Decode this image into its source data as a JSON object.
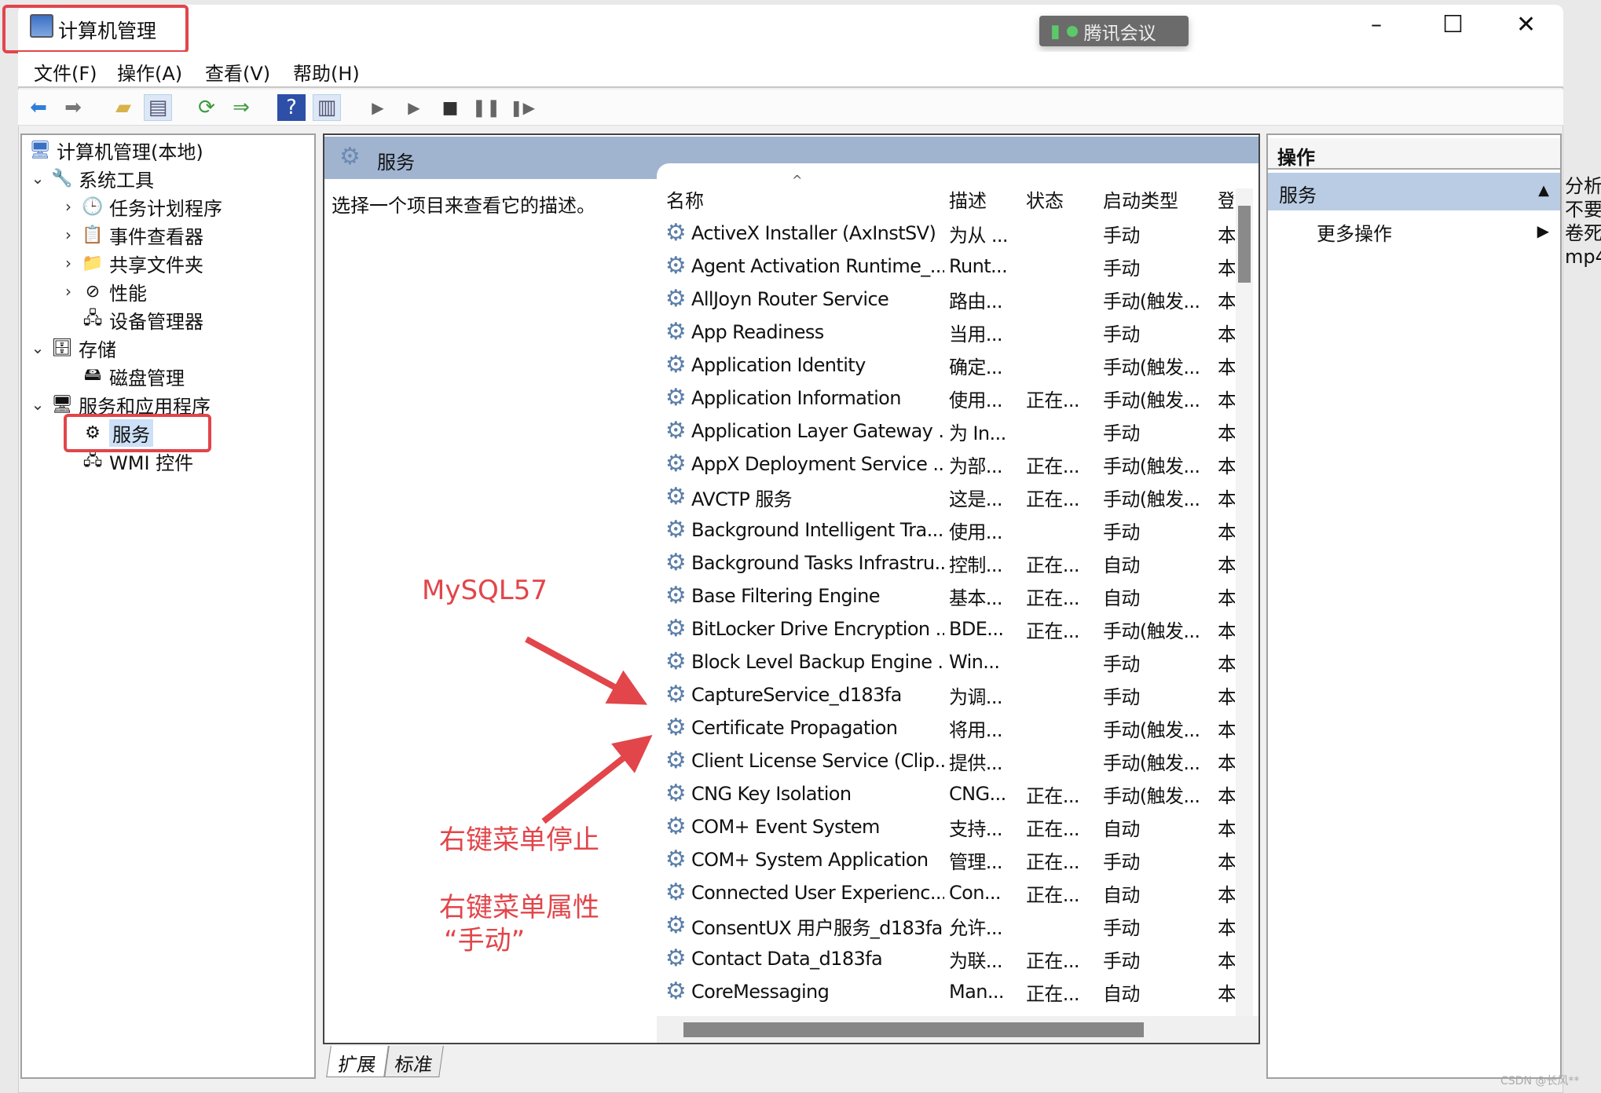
{
  "window": {
    "title": "计算机管理",
    "controls": {
      "minimize": "–",
      "maximize": "☐",
      "close": "✕"
    }
  },
  "meeting_badge": {
    "label": "腾讯会议",
    "color": "#5cc86a"
  },
  "menu": [
    "文件(F)",
    "操作(A)",
    "查看(V)",
    "帮助(H)"
  ],
  "toolbar": [
    "back-arrow",
    "forward-arrow",
    "up-folder",
    "show-hide-tree",
    "refresh",
    "export-list",
    "help",
    "show-hide-action-pane",
    "start-service",
    "start-service-alt",
    "stop-service",
    "pause-service",
    "resume-service"
  ],
  "tree": {
    "root": "计算机管理(本地)",
    "items": [
      {
        "label": "系统工具",
        "level": 1,
        "expanded": true
      },
      {
        "label": "任务计划程序",
        "level": 2
      },
      {
        "label": "事件查看器",
        "level": 2
      },
      {
        "label": "共享文件夹",
        "level": 2
      },
      {
        "label": "性能",
        "level": 2
      },
      {
        "label": "设备管理器",
        "level": 2,
        "leaf": true
      },
      {
        "label": "存储",
        "level": 1,
        "expanded": true
      },
      {
        "label": "磁盘管理",
        "level": 2,
        "leaf": true
      },
      {
        "label": "服务和应用程序",
        "level": 1,
        "expanded": true
      },
      {
        "label": "服务",
        "level": 2,
        "leaf": true,
        "selected": true
      },
      {
        "label": "WMI 控件",
        "level": 2,
        "leaf": true
      }
    ]
  },
  "center": {
    "header": "服务",
    "description": "选择一个项目来查看它的描述。",
    "columns": [
      "名称",
      "描述",
      "状态",
      "启动类型",
      "登"
    ],
    "rows": [
      [
        "ActiveX Installer (AxInstSV)",
        "为从 ...",
        "",
        "手动",
        "本"
      ],
      [
        "Agent Activation Runtime_...",
        "Runt...",
        "",
        "手动",
        "本"
      ],
      [
        "AllJoyn Router Service",
        "路由...",
        "",
        "手动(触发...",
        "本"
      ],
      [
        "App Readiness",
        "当用...",
        "",
        "手动",
        "本"
      ],
      [
        "Application Identity",
        "确定...",
        "",
        "手动(触发...",
        "本"
      ],
      [
        "Application Information",
        "使用...",
        "正在...",
        "手动(触发...",
        "本"
      ],
      [
        "Application Layer Gateway ...",
        "为 In...",
        "",
        "手动",
        "本"
      ],
      [
        "AppX Deployment Service ...",
        "为部...",
        "正在...",
        "手动(触发...",
        "本"
      ],
      [
        "AVCTP 服务",
        "这是...",
        "正在...",
        "手动(触发...",
        "本"
      ],
      [
        "Background Intelligent Tra...",
        "使用...",
        "",
        "手动",
        "本"
      ],
      [
        "Background Tasks Infrastru...",
        "控制...",
        "正在...",
        "自动",
        "本"
      ],
      [
        "Base Filtering Engine",
        "基本...",
        "正在...",
        "自动",
        "本"
      ],
      [
        "BitLocker Drive Encryption ...",
        "BDE...",
        "正在...",
        "手动(触发...",
        "本"
      ],
      [
        "Block Level Backup Engine ...",
        "Win...",
        "",
        "手动",
        "本"
      ],
      [
        "CaptureService_d183fa",
        "为调...",
        "",
        "手动",
        "本"
      ],
      [
        "Certificate Propagation",
        "将用...",
        "",
        "手动(触发...",
        "本"
      ],
      [
        "Client License Service (Clip...",
        "提供...",
        "",
        "手动(触发...",
        "本"
      ],
      [
        "CNG Key Isolation",
        "CNG...",
        "正在...",
        "手动(触发...",
        "本"
      ],
      [
        "COM+ Event System",
        "支持...",
        "正在...",
        "自动",
        "本"
      ],
      [
        "COM+ System Application",
        "管理...",
        "正在...",
        "手动",
        "本"
      ],
      [
        "Connected User Experienc...",
        "Con...",
        "正在...",
        "自动",
        "本"
      ],
      [
        "ConsentUX 用户服务_d183fa",
        "允许...",
        "",
        "手动",
        "本"
      ],
      [
        "Contact Data_d183fa",
        "为联...",
        "正在...",
        "手动",
        "本"
      ],
      [
        "CoreMessaging",
        "Man...",
        "正在...",
        "自动",
        "本"
      ]
    ],
    "tabs": [
      "扩展",
      "标准"
    ]
  },
  "actions": {
    "header": "操作",
    "section": "服务",
    "item": "更多操作"
  },
  "annotations": {
    "service": "MySQL57",
    "note1": "右键菜单停止",
    "note2": "右键菜单属性",
    "note3": "“手动”",
    "color": "#e2454a"
  },
  "background_text": [
    "分析到",
    "不要“",
    "卷死",
    "mp4"
  ],
  "watermark": "CSDN @长风**"
}
